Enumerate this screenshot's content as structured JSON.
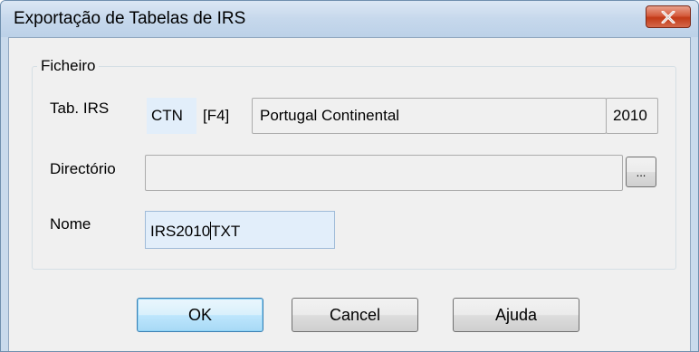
{
  "window": {
    "title": "Exportação de Tabelas de IRS"
  },
  "group": {
    "label": "Ficheiro"
  },
  "fields": {
    "tab_irs": {
      "label": "Tab. IRS",
      "code": "CTN",
      "shortcut": "[F4]",
      "description": "Portugal Continental",
      "year": "2010"
    },
    "directorio": {
      "label": "Directório",
      "value": "",
      "browse_label": "..."
    },
    "nome": {
      "label": "Nome",
      "value_before_caret": "IRS2010",
      "value_after_caret": "TXT"
    }
  },
  "buttons": {
    "ok": "OK",
    "cancel": "Cancel",
    "help": "Ajuda"
  },
  "icons": {
    "close": "close-icon"
  }
}
